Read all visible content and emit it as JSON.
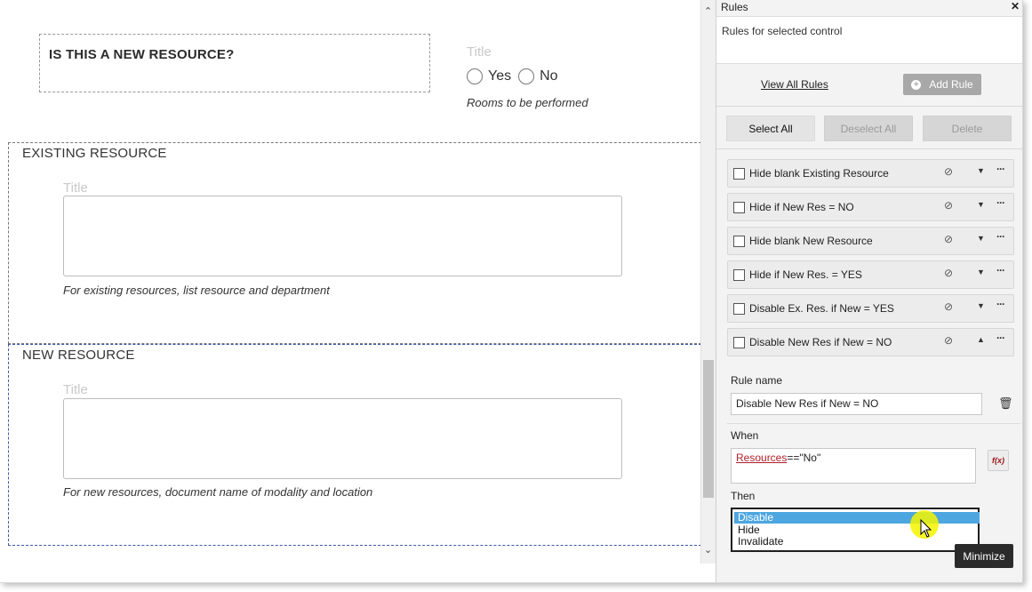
{
  "form": {
    "question_title": "IS THIS A NEW RESOURCE?",
    "radio_title_placeholder": "Title",
    "radio_options": [
      "Yes",
      "No"
    ],
    "radio_hint": "Rooms to be performed",
    "sections": [
      {
        "title": "EXISTING RESOURCE",
        "field_title_placeholder": "Title",
        "hint": "For existing resources, list resource and department"
      },
      {
        "title": "NEW RESOURCE",
        "field_title_placeholder": "Title",
        "hint": "For new resources, document name of modality and location"
      }
    ]
  },
  "panel": {
    "title": "Rules",
    "close_icon": "close-icon",
    "subtitle": "Rules for selected control",
    "view_all": "View All Rules",
    "add_rule": "Add Rule",
    "buttons": {
      "select_all": "Select All",
      "deselect_all": "Deselect All",
      "delete": "Delete"
    },
    "rules": [
      {
        "label": "Hide blank Existing Resource",
        "expanded": false
      },
      {
        "label": "Hide if New Res = NO",
        "expanded": false
      },
      {
        "label": "Hide blank New Resource",
        "expanded": false
      },
      {
        "label": "Hide if New Res. = YES",
        "expanded": false
      },
      {
        "label": "Disable Ex. Res. if New = YES",
        "expanded": false
      },
      {
        "label": "Disable New Res if New = NO",
        "expanded": true
      }
    ],
    "detail": {
      "rule_name_label": "Rule name",
      "rule_name_value": "Disable New Res if New = NO",
      "when_label": "When",
      "when_ref": "Resources",
      "when_rest": "==\"No\"",
      "fx_label": "f(x)",
      "then_label": "Then",
      "then_options": [
        "Disable",
        "Hide",
        "Invalidate"
      ],
      "then_selected": "Disable"
    },
    "minimize": "Minimize"
  },
  "colors": {
    "accent_selected": "#4da6e0",
    "reference_red": "#b0202a",
    "panel_bg": "#f3f3f3"
  }
}
